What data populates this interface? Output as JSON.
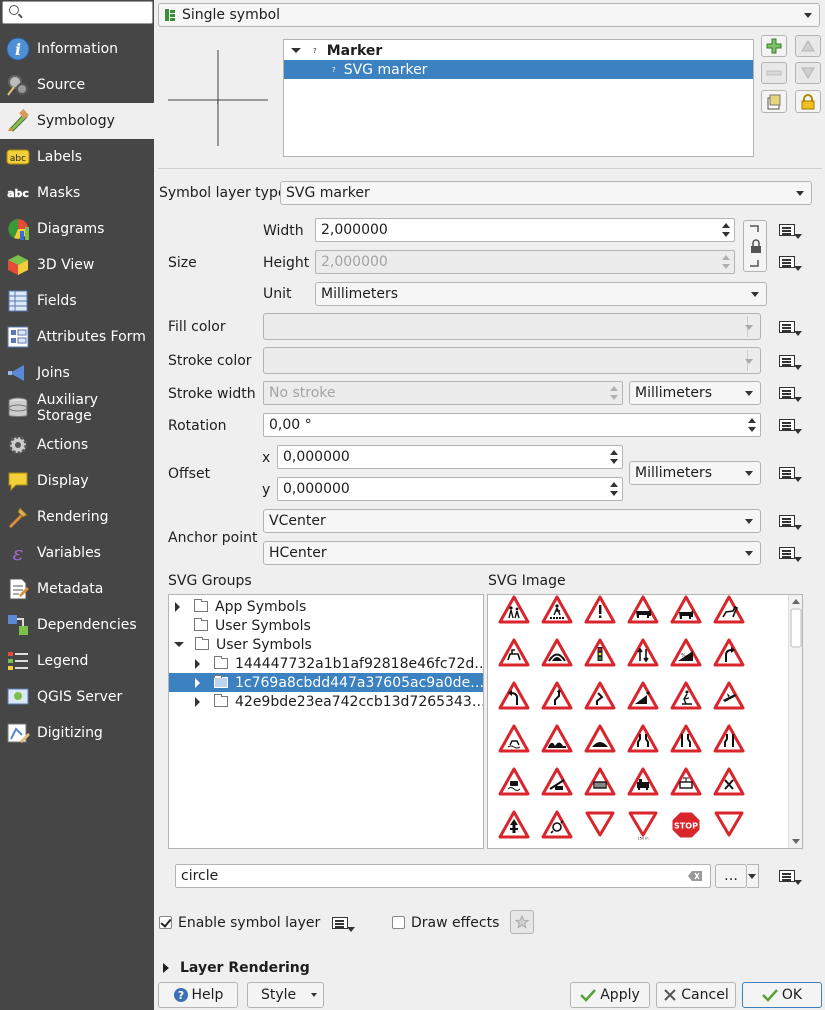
{
  "sidebar": {
    "search_placeholder": "",
    "items": [
      {
        "label": "Information",
        "icon": "info-icon",
        "active": false
      },
      {
        "label": "Source",
        "icon": "source-icon",
        "active": false
      },
      {
        "label": "Symbology",
        "icon": "symbology-icon",
        "active": true
      },
      {
        "label": "Labels",
        "icon": "labels-icon",
        "active": false
      },
      {
        "label": "Masks",
        "icon": "masks-icon",
        "active": false
      },
      {
        "label": "Diagrams",
        "icon": "diagrams-icon",
        "active": false
      },
      {
        "label": "3D View",
        "icon": "3d-view-icon",
        "active": false
      },
      {
        "label": "Fields",
        "icon": "fields-icon",
        "active": false
      },
      {
        "label": "Attributes Form",
        "icon": "attributes-form-icon",
        "active": false
      },
      {
        "label": "Joins",
        "icon": "joins-icon",
        "active": false
      },
      {
        "label": "Auxiliary\nStorage",
        "icon": "auxiliary-storage-icon",
        "active": false
      },
      {
        "label": "Actions",
        "icon": "actions-icon",
        "active": false
      },
      {
        "label": "Display",
        "icon": "display-icon",
        "active": false
      },
      {
        "label": "Rendering",
        "icon": "rendering-icon",
        "active": false
      },
      {
        "label": "Variables",
        "icon": "variables-icon",
        "active": false
      },
      {
        "label": "Metadata",
        "icon": "metadata-icon",
        "active": false
      },
      {
        "label": "Dependencies",
        "icon": "dependencies-icon",
        "active": false
      },
      {
        "label": "Legend",
        "icon": "legend-icon",
        "active": false
      },
      {
        "label": "QGIS Server",
        "icon": "qgis-server-icon",
        "active": false
      },
      {
        "label": "Digitizing",
        "icon": "digitizing-icon",
        "active": false
      }
    ]
  },
  "renderer": {
    "selected": "Single symbol"
  },
  "layer_tree": {
    "marker_label": "Marker",
    "svg_marker_label": "SVG marker"
  },
  "symbol_layer_type": {
    "label": "Symbol layer type",
    "value": "SVG marker"
  },
  "size": {
    "label": "Size",
    "width_label": "Width",
    "width_value": "2,000000",
    "height_label": "Height",
    "height_value": "2,000000",
    "unit_label": "Unit",
    "unit_value": "Millimeters"
  },
  "fill_color": {
    "label": "Fill color"
  },
  "stroke_color": {
    "label": "Stroke color"
  },
  "stroke_width": {
    "label": "Stroke width",
    "value": "No stroke",
    "unit": "Millimeters"
  },
  "rotation": {
    "label": "Rotation",
    "value": "0,00 °"
  },
  "offset": {
    "label": "Offset",
    "x_label": "x",
    "x_value": "0,000000",
    "y_label": "y",
    "y_value": "0,000000",
    "unit": "Millimeters"
  },
  "anchor": {
    "label": "Anchor point",
    "vertical": "VCenter",
    "horizontal": "HCenter"
  },
  "svg_groups": {
    "label": "SVG Groups",
    "rows": [
      {
        "text": "App Symbols",
        "indent": 0,
        "expander": "right",
        "selected": false
      },
      {
        "text": "User Symbols",
        "indent": 0,
        "expander": "none",
        "selected": false
      },
      {
        "text": "User Symbols",
        "indent": 0,
        "expander": "down",
        "selected": false
      },
      {
        "text": "144447732a1b1af92818e46fc72d…",
        "indent": 1,
        "expander": "right",
        "selected": false
      },
      {
        "text": "1c769a8cbdd447a37605ac9a0de…",
        "indent": 1,
        "expander": "right",
        "selected": true
      },
      {
        "text": "42e9bde23ea742ccb13d7265343…",
        "indent": 1,
        "expander": "right",
        "selected": false
      }
    ]
  },
  "svg_image": {
    "label": "SVG Image",
    "signs": [
      [
        "warning-two-children-icon",
        "warning-pedestrian-crossing-icon",
        "warning-exclamation-icon",
        "warning-cattle-icon",
        "warning-cow-icon",
        "warning-deer-icon"
      ],
      [
        "warning-horse-rider-icon",
        "warning-tunnel-icon",
        "warning-traffic-lights-icon",
        "warning-two-way-traffic-icon",
        "warning-steep-descent-icon",
        "warning-curve-right-icon"
      ],
      [
        "warning-curve-left-icon",
        "warning-double-curve-icon",
        "warning-winding-road-icon",
        "warning-falling-rocks-icon",
        "warning-roadworks-icon",
        "warning-aircraft-icon"
      ],
      [
        "warning-slippery-road-icon",
        "warning-uneven-road-icon",
        "warning-hump-icon",
        "warning-road-narrows-both-icon",
        "warning-road-narrows-icon",
        "warning-road-narrows-left-icon"
      ],
      [
        "warning-car-skidding-icon",
        "warning-level-crossing-barrier-icon",
        "warning-level-crossing-icon",
        "warning-train-icon",
        "warning-tram-icon",
        "warning-crossroads-icon"
      ],
      [
        "warning-priority-road-icon",
        "warning-roundabout-icon",
        "yield-sign-icon",
        "yield-distance-sign-icon",
        "stop-sign-icon",
        "yield-stop-ahead-icon"
      ]
    ],
    "stop_text": "STOP",
    "yield_distance_text": "150 m"
  },
  "svg_path": {
    "value": "circle",
    "browse_label": "…"
  },
  "enable_symbol_layer": {
    "label": "Enable symbol layer",
    "checked": true
  },
  "draw_effects": {
    "label": "Draw effects",
    "checked": false
  },
  "layer_rendering": {
    "label": "Layer Rendering"
  },
  "buttons": {
    "help": "Help",
    "style": "Style",
    "apply": "Apply",
    "cancel": "Cancel",
    "ok": "OK"
  }
}
